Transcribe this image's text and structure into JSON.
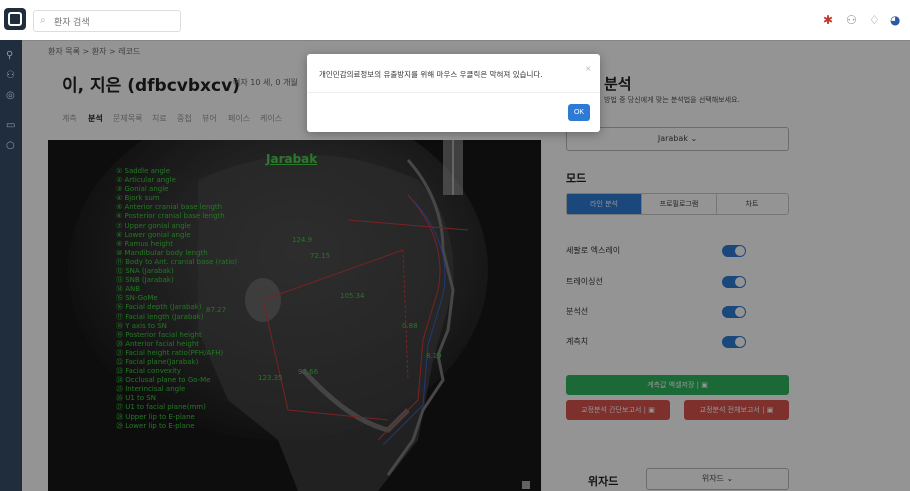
{
  "topbar": {
    "search_placeholder": "환자 검색"
  },
  "breadcrumb": "환자 목록 > 환자 > 레코드",
  "patient": {
    "name": "이, 지은 (dfbcvbxcv)",
    "info": "여자  10 세, 0 개월"
  },
  "tabs": [
    "계측",
    "분석",
    "문제목록",
    "치료",
    "중첩",
    "뷰어",
    "페이스",
    "케이스"
  ],
  "xray": {
    "title": "Jarabak",
    "measurements": [
      "① Saddle angle",
      "② Articular angle",
      "③ Gonial angle",
      "④ Bjork sum",
      "⑤ Anterior cranial base length",
      "⑥ Posterior cranial base length",
      "⑦ Upper gonial angle",
      "⑧ Lower gonial angle",
      "⑨ Ramus height",
      "⑩ Mandibular body length",
      "⑪ Body to Ant. cranial base (ratio)",
      "⑫ SNA (Jarabak)",
      "⑬ SNB (Jarabak)",
      "⑭ ANB",
      "⑮ SN-GoMe",
      "⑯ Facial depth (Jarabak)",
      "⑰ Facial length (Jarabak)",
      "⑱ Y axis to SN",
      "⑲ Posterior facial height",
      "⑳ Anterior facial height",
      "㉑ Facial height ratio(PFH/AFH)",
      "㉒ Facial plane(Jarabak)",
      "㉓ Facial convexity",
      "㉔ Occlusal plane to Go-Me",
      "㉕ Interincisal angle",
      "㉖ U1 to SN",
      "㉗ U1 to facial plane(mm)",
      "㉘ Upper lip to E-plane",
      "㉙ Lower lip to E-plane"
    ],
    "values": [
      "124.9",
      "72.15",
      "105.34",
      "87.27",
      "8.19",
      "123.35",
      "92.66",
      "0.88"
    ]
  },
  "right_panel": {
    "title": "분석",
    "subtitle": "방법 중 당신에게 맞는 분석법을 선택해보세요.",
    "analysis_select": "Jarabak ⌄",
    "mode_label": "모드",
    "mode_buttons": [
      "라인 분석",
      "프로필로그램",
      "차트"
    ],
    "toggles": [
      {
        "label": "세팔로 엑스레이",
        "on": true
      },
      {
        "label": "트레이싱선",
        "on": true
      },
      {
        "label": "분석선",
        "on": true
      },
      {
        "label": "계측치",
        "on": true
      }
    ],
    "excel_button": "계측값 엑셀저장 |",
    "report_buttons": [
      "교정분석 간단보고서 |",
      "교정분석 전체보고서 |"
    ],
    "wizard_label": "위자드",
    "wizard_select": "위자드 ⌄"
  },
  "modal": {
    "message": "개인민감의료정보의 유출방지를 위해 마우스 우클릭은 막혀져 있습니다.",
    "close": "×",
    "ok": "OK"
  }
}
